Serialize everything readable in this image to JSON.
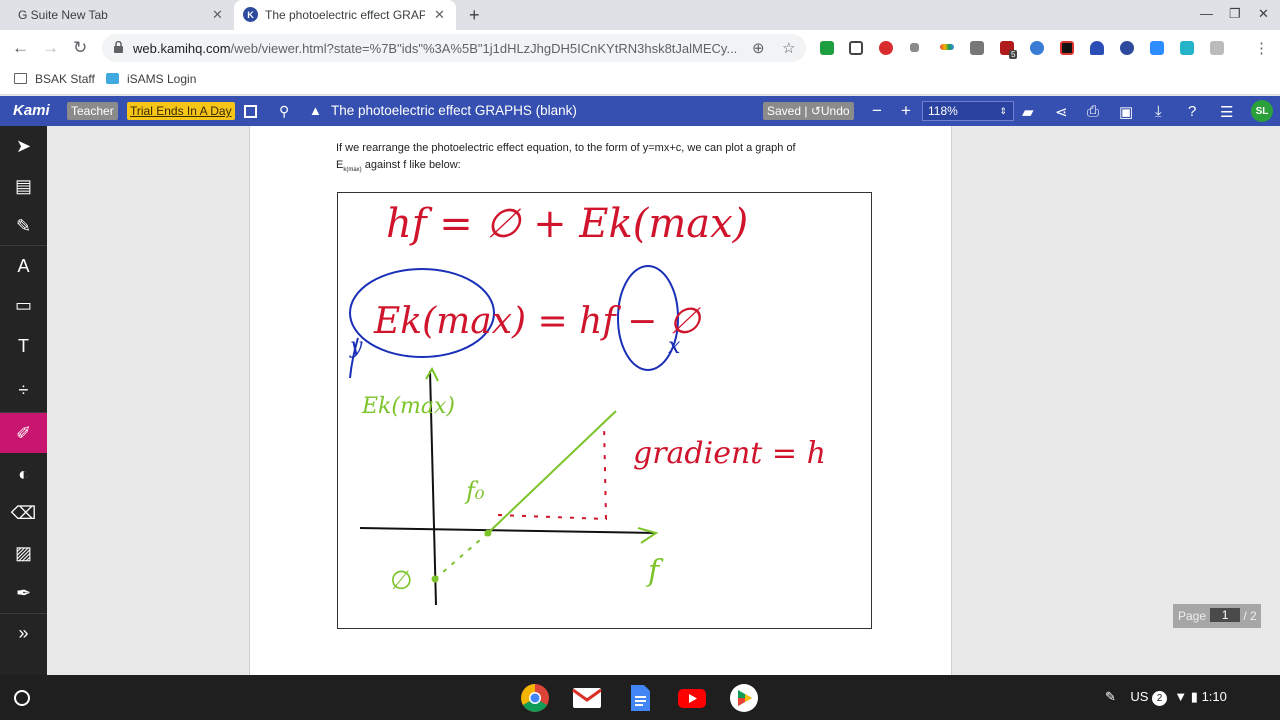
{
  "browser": {
    "tabs": [
      {
        "title": "G Suite New Tab",
        "active": false
      },
      {
        "title": "The photoelectric effect GRAPHS",
        "active": true
      }
    ],
    "url_main": "web.kamihq.com",
    "url_rest": "/web/viewer.html?state=%7B\"ids\"%3A%5B\"1j1dHLzJhgDH5ICnKYtRN3hsk8tJalMECy...",
    "extension_badge": "5",
    "bookmarks": [
      "BSAK Staff",
      "iSAMS Login"
    ]
  },
  "kami": {
    "logo": "Kami",
    "teacher_label": "Teacher",
    "trial_label": "Trial Ends In A Day",
    "doc_title": "The photoelectric effect GRAPHS (blank)",
    "saved_label": "Saved",
    "undo_label": "Undo",
    "zoom": "118%",
    "avatar": "SL",
    "accent_color": "#3550b0",
    "active_tool_color": "#c8156f"
  },
  "document": {
    "intro_line1": "If we rearrange the photoelectric effect equation, to the form of y=mx+c, we can plot a graph of",
    "intro_e": "E",
    "intro_sub": "k(max)",
    "intro_line2_rest": " against f like below:",
    "page_label": "Page",
    "page_current": "1",
    "page_total": "/ 2",
    "handwriting": {
      "equation1": "hf = ∅ + Ek(max)",
      "equation2": "Ek(max) = hf − ∅",
      "y_var": "y",
      "x_var": "x",
      "y_axis": "Ek(max)",
      "x_axis": "f",
      "f0": "f₀",
      "intercept": "∅",
      "gradient": "gradient = h"
    }
  },
  "shelf": {
    "lang": "US",
    "notifications": "2",
    "time": "1:10"
  }
}
